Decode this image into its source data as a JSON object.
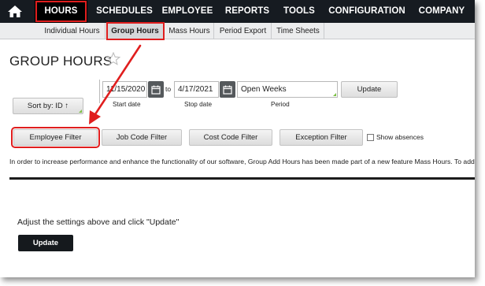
{
  "topnav": {
    "home_icon": "home-icon",
    "items": [
      "HOURS",
      "SCHEDULES",
      "EMPLOYEE",
      "REPORTS",
      "TOOLS",
      "CONFIGURATION",
      "COMPANY"
    ]
  },
  "subnav": {
    "items": [
      "Individual Hours",
      "Group Hours",
      "Mass Hours",
      "Period Export",
      "Time Sheets"
    ],
    "active": "Group Hours"
  },
  "page": {
    "title": "GROUP HOURS",
    "star_icon": "star-icon"
  },
  "controls": {
    "sort_button": "Sort by: ID ↑",
    "start_date": "11/15/2020",
    "to_label": "to",
    "stop_date": "4/17/2021",
    "period_value": "Open Weeks",
    "update_button": "Update",
    "start_label": "Start date",
    "stop_label": "Stop date",
    "period_label": "Period"
  },
  "filters": {
    "employee": "Employee Filter",
    "job_code": "Job Code Filter",
    "cost_code": "Cost Code Filter",
    "exception": "Exception Filter",
    "show_absences": "Show absences"
  },
  "info_text": "In order to increase performance and enhance the functionality of our software, Group Add Hours has been made part of a new feature Mass Hours. To add or edit h",
  "result": {
    "message": "Adjust the settings above and click \"Update\"",
    "update_button": "Update"
  },
  "colors": {
    "nav_bg": "#161b21",
    "highlight": "#e01e1e",
    "accent_green": "#7bc043"
  }
}
